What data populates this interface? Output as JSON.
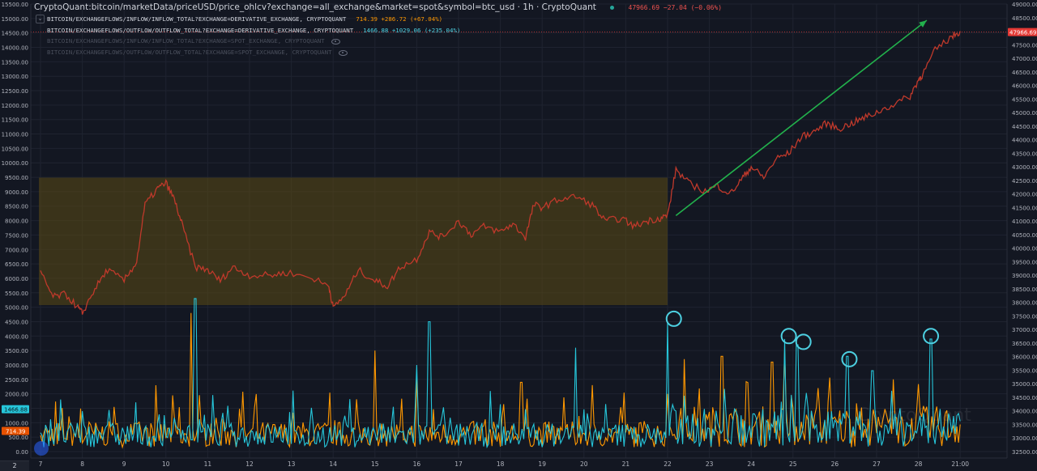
{
  "header": {
    "title": "CryptoQuant:bitcoin/marketData/priceUSD/price_ohlcv?exchange=all_exchange&market=spot&symbol=btc_usd · 1h · CryptoQuant",
    "values": "47966.69 −27.04 (−0.06%)",
    "series_rows": [
      {
        "label": "BITCOIN/EXCHANGEFLOWS/INFLOW/INFLOW_TOTAL?EXCHANGE=DERIVATIVE_EXCHANGE, CRYPTOQUANT",
        "value": "714.39 +286.72 (+67.04%)"
      },
      {
        "label": "BITCOIN/EXCHANGEFLOWS/OUTFLOW/OUTFLOW_TOTAL?EXCHANGE=DERIVATIVE_EXCHANGE, CRYPTOQUANT",
        "value": "1466.88 +1029.06 (+235.04%)"
      },
      {
        "label": "BITCOIN/EXCHANGEFLOWS/INFLOW/INFLOW_TOTAL?EXCHANGE=SPOT_EXCHANGE, CRYPTOQUANT",
        "value": ""
      },
      {
        "label": "BITCOIN/EXCHANGEFLOWS/OUTFLOW/OUTFLOW_TOTAL?EXCHANGE=SPOT_EXCHANGE, CRYPTOQUANT",
        "value": ""
      }
    ]
  },
  "watermark": "CryptoQuant",
  "bottom_badge": "2",
  "colors": {
    "background": "#131722",
    "grid": "#1f2330",
    "price": "#c0392b",
    "inflow": "#ff9800",
    "outflow": "#26c6da",
    "zone": "#5b4a14",
    "arrow": "#22b14c",
    "circle": "#4dd0e1",
    "right_badge": "#e53935",
    "left_badge_outflow": "#26c6da",
    "left_badge_inflow": "#e65100"
  },
  "chart_data": {
    "type": "line",
    "x_ticks": [
      "7",
      "8",
      "9",
      "10",
      "11",
      "12",
      "13",
      "14",
      "15",
      "16",
      "17",
      "18",
      "19",
      "20",
      "21",
      "22",
      "23",
      "24",
      "25",
      "26",
      "27",
      "28",
      "21:00"
    ],
    "left_axis": {
      "ticks": [
        "15500.00",
        "15000.00",
        "14500.00",
        "14000.00",
        "13500.00",
        "13000.00",
        "12500.00",
        "12000.00",
        "11500.00",
        "11000.00",
        "10500.00",
        "10000.00",
        "9500.00",
        "9000.00",
        "8500.00",
        "8000.00",
        "7500.00",
        "7000.00",
        "6500.00",
        "6000.00",
        "5500.00",
        "5000.00",
        "4500.00",
        "4000.00",
        "3500.00",
        "3000.00",
        "2500.00",
        "2000.00",
        "1500.00",
        "1000.00",
        "500.00",
        "0.00"
      ],
      "range": [
        0,
        15500
      ],
      "last_outflow_label": "1466.88",
      "last_inflow_label": "714.39"
    },
    "right_axis": {
      "ticks": [
        "49000.00",
        "48500.00",
        "47500.00",
        "47000.00",
        "46500.00",
        "46000.00",
        "45500.00",
        "45000.00",
        "44500.00",
        "44000.00",
        "43500.00",
        "43000.00",
        "42500.00",
        "42000.00",
        "41500.00",
        "41000.00",
        "40500.00",
        "40000.00",
        "39500.00",
        "39000.00",
        "38500.00",
        "38000.00",
        "37500.00",
        "37000.00",
        "36500.00",
        "36000.00",
        "35500.00",
        "35000.00",
        "34500.00",
        "34000.00",
        "33500.00",
        "33000.00",
        "32500.00"
      ],
      "range": [
        32500,
        49000
      ],
      "last_price_label": "47966.69"
    },
    "price_series": {
      "name": "",
      "points": [
        [
          7.0,
          39100
        ],
        [
          7.3,
          38200
        ],
        [
          7.6,
          38300
        ],
        [
          7.9,
          37800
        ],
        [
          8.0,
          37600
        ],
        [
          8.3,
          38500
        ],
        [
          8.6,
          39200
        ],
        [
          9.0,
          38800
        ],
        [
          9.3,
          39500
        ],
        [
          9.5,
          41600
        ],
        [
          9.8,
          42200
        ],
        [
          10.0,
          42400
        ],
        [
          10.2,
          41800
        ],
        [
          10.4,
          40800
        ],
        [
          10.7,
          39300
        ],
        [
          11.0,
          39200
        ],
        [
          11.3,
          38800
        ],
        [
          11.6,
          39300
        ],
        [
          12.0,
          39000
        ],
        [
          12.5,
          39000
        ],
        [
          12.9,
          39100
        ],
        [
          13.5,
          38900
        ],
        [
          13.9,
          38600
        ],
        [
          14.0,
          37800
        ],
        [
          14.3,
          38300
        ],
        [
          14.6,
          39200
        ],
        [
          15.0,
          38800
        ],
        [
          15.3,
          38600
        ],
        [
          15.6,
          39300
        ],
        [
          16.0,
          39600
        ],
        [
          16.3,
          40600
        ],
        [
          16.6,
          40400
        ],
        [
          17.0,
          41000
        ],
        [
          17.3,
          40500
        ],
        [
          17.6,
          40800
        ],
        [
          18.0,
          40600
        ],
        [
          18.3,
          40900
        ],
        [
          18.6,
          40400
        ],
        [
          18.8,
          41600
        ],
        [
          19.0,
          41500
        ],
        [
          19.4,
          41800
        ],
        [
          19.8,
          41900
        ],
        [
          20.2,
          41600
        ],
        [
          20.5,
          41000
        ],
        [
          20.9,
          41100
        ],
        [
          21.2,
          40800
        ],
        [
          21.5,
          41000
        ],
        [
          21.8,
          41100
        ],
        [
          22.0,
          41200
        ],
        [
          22.2,
          42900
        ],
        [
          22.5,
          42400
        ],
        [
          22.9,
          42100
        ],
        [
          23.2,
          42300
        ],
        [
          23.5,
          42000
        ],
        [
          23.8,
          42600
        ],
        [
          24.0,
          43000
        ],
        [
          24.3,
          42600
        ],
        [
          24.6,
          43300
        ],
        [
          24.9,
          43500
        ],
        [
          25.2,
          44100
        ],
        [
          25.5,
          44300
        ],
        [
          25.8,
          44600
        ],
        [
          26.1,
          44400
        ],
        [
          26.4,
          44600
        ],
        [
          26.7,
          44800
        ],
        [
          27.0,
          45000
        ],
        [
          27.4,
          45300
        ],
        [
          27.8,
          45600
        ],
        [
          28.0,
          46200
        ],
        [
          28.1,
          46400
        ],
        [
          28.4,
          47300
        ],
        [
          28.8,
          47800
        ],
        [
          29.0,
          48000
        ]
      ]
    },
    "inflow_series": {
      "name": "",
      "spikes": [
        [
          10.6,
          4800
        ],
        [
          15.0,
          3500
        ],
        [
          16.0,
          2600
        ],
        [
          18.5,
          2400
        ],
        [
          20.2,
          2300
        ],
        [
          22.0,
          2000
        ],
        [
          22.4,
          3200
        ],
        [
          23.3,
          3300
        ],
        [
          24.5,
          3100
        ],
        [
          24.8,
          3500
        ],
        [
          25.6,
          2200
        ],
        [
          27.4,
          2500
        ]
      ]
    },
    "outflow_series": {
      "name": "",
      "spikes": [
        [
          10.7,
          5300
        ],
        [
          16.3,
          4500
        ],
        [
          16.0,
          3000
        ],
        [
          19.8,
          3600
        ],
        [
          22.0,
          4500
        ],
        [
          24.8,
          3900
        ],
        [
          25.1,
          3700
        ],
        [
          26.3,
          3300
        ],
        [
          28.3,
          3900
        ],
        [
          26.9,
          2800
        ]
      ]
    },
    "highlight_zone": {
      "x": [
        7.0,
        22.0
      ],
      "price_range": [
        37900,
        42600
      ]
    },
    "trend_arrow": {
      "from": [
        22.2,
        41200
      ],
      "to": [
        28.2,
        48400
      ]
    },
    "circled_peaks": [
      [
        22.15,
        4600
      ],
      [
        24.9,
        4000
      ],
      [
        25.25,
        3800
      ],
      [
        26.35,
        3200
      ],
      [
        28.3,
        4000
      ]
    ]
  }
}
